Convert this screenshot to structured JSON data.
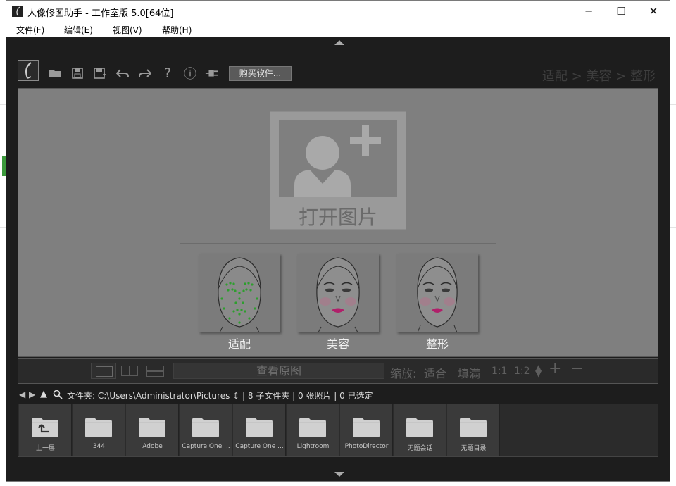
{
  "window": {
    "title": "人像修图助手 - 工作室版 5.0[64位]",
    "controls": {
      "minimize": "─",
      "maximize": "☐",
      "close": "✕"
    }
  },
  "menu": [
    "文件(F)",
    "编辑(E)",
    "视图(V)",
    "帮助(H)"
  ],
  "toolbar": {
    "icons": [
      "logo-icon",
      "open-folder-icon",
      "save-icon",
      "save-as-icon",
      "undo-icon",
      "redo-icon",
      "help-icon",
      "info-icon",
      "plugin-icon"
    ],
    "help_glyph": "?",
    "info_glyph": "ⓘ",
    "buy_label": "购买软件...",
    "breadcrumb": "适配 > 美容 > 整形"
  },
  "canvas": {
    "open_label": "打开图片",
    "steps": [
      "适配",
      "美容",
      "整形"
    ]
  },
  "viewbar": {
    "view_original": "查看原图",
    "zoom_label": "缩放:",
    "fit": "适合",
    "fill": "填满",
    "ratio1": "1:1",
    "ratio2": "1:2",
    "plus": "+",
    "minus": "−"
  },
  "pathbar": {
    "text": "文件夹: C:\\Users\\Administrator\\Pictures ⇕ | 8 子文件夹 | 0 张照片 | 0 已选定"
  },
  "folders": [
    "上一层",
    "344",
    "Adobe",
    "Capture One ...",
    "Capture One ...",
    "Lightroom",
    "PhotoDirector",
    "无题会话",
    "无题目录"
  ],
  "colors": {
    "canvas": "#7f7f7f",
    "app_bg": "#1d1d1d",
    "dots_green": "#2e9e2e",
    "lips": "#b0206a"
  }
}
